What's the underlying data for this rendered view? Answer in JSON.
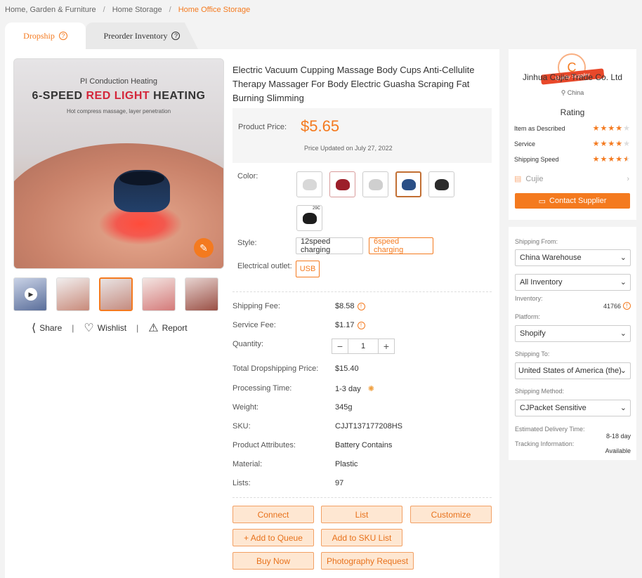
{
  "breadcrumb": [
    "Home, Garden & Furniture",
    "Home Storage",
    "Home Office Storage"
  ],
  "tabs": {
    "dropship": "Dropship",
    "preorder": "Preorder Inventory"
  },
  "hero": {
    "subtitle": "PI Conduction Heating",
    "title_prefix": "6-SPEED ",
    "title_highlight": "RED LIGHT",
    "title_suffix": " HEATING",
    "caption": "Hot compress massage, layer penetration"
  },
  "social": {
    "share": "Share",
    "wishlist": "Wishlist",
    "report": "Report"
  },
  "product": {
    "title": "Electric Vacuum Cupping Massage Body Cups Anti-Cellulite Therapy Massager For Body Electric Guasha Scraping Fat Burning Slimming",
    "price_label": "Product Price:",
    "price": "$5.65",
    "price_updated": "Price Updated on July 27, 2022",
    "color_label": "Color:",
    "swatch_badge": "29C",
    "style_label": "Style:",
    "styles": [
      "12speed charging",
      "6speed charging"
    ],
    "outlet_label": "Electrical outlet:",
    "outlet": "USB",
    "colors": [
      "#d8d8d8",
      "#9c1f2a",
      "#cfcfcf",
      "#2a4f86",
      "#2b2b2b",
      "#1d1d1d"
    ]
  },
  "details": {
    "shipping_fee_k": "Shipping Fee:",
    "shipping_fee_v": "$8.58",
    "service_fee_k": "Service Fee:",
    "service_fee_v": "$1.17",
    "quantity_k": "Quantity:",
    "quantity_v": "1",
    "total_k": "Total Dropshipping Price:",
    "total_v": "$15.40",
    "processing_k": "Processing Time:",
    "processing_v": "1-3 day",
    "weight_k": "Weight:",
    "weight_v": "345g",
    "sku_k": "SKU:",
    "sku_v": "CJJT137177208HS",
    "attributes_k": "Product Attributes:",
    "attributes_v": "Battery Contains",
    "material_k": "Material:",
    "material_v": "Plastic",
    "lists_k": "Lists:",
    "lists_v": "97"
  },
  "actions": {
    "connect": "Connect",
    "list": "List",
    "customize": "Customize",
    "add_queue": "+ Add to Queue",
    "add_sku": "Add to SKU List",
    "buy_now": "Buy Now",
    "photography": "Photography Request"
  },
  "supplier": {
    "badge_letter": "C",
    "badge_text": "Quality Supplier",
    "name": "Jinhua Cujie Trade Co. Ltd",
    "country": "China",
    "rating_title": "Rating",
    "ratings": [
      {
        "label": "Item as Described",
        "stars": 4
      },
      {
        "label": "Service",
        "stars": 4
      },
      {
        "label": "Shipping Speed",
        "stars": 4.5
      }
    ],
    "store": "Cujie",
    "contact": "Contact Supplier"
  },
  "shipping": {
    "from_label": "Shipping From:",
    "from_value": "China Warehouse",
    "inventory_filter": "All Inventory",
    "inventory_label": "Inventory:",
    "inventory_value": "41766",
    "platform_label": "Platform:",
    "platform_value": "Shopify",
    "to_label": "Shipping To:",
    "to_value": "United States of America (the)",
    "method_label": "Shipping Method:",
    "method_value": "CJPacket Sensitive",
    "delivery_label": "Estimated Delivery Time:",
    "delivery_value": "8-18 day",
    "tracking_label": "Tracking Information:",
    "tracking_value": "Available"
  }
}
